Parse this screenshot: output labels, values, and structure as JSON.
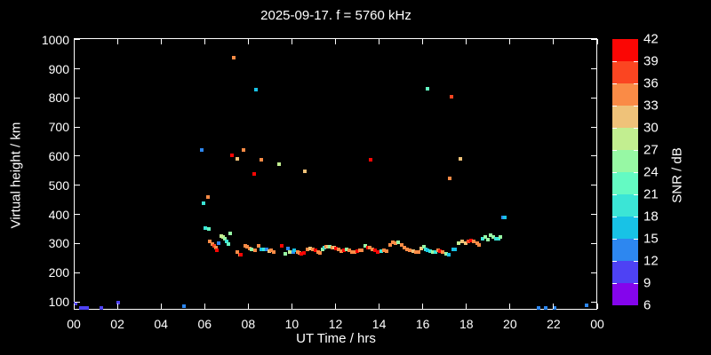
{
  "colors": {
    "background": "#000000",
    "axis": "#ffffff",
    "text": "#ffffff"
  },
  "header": {
    "title": "2025-09-17. f = 5760 kHz"
  },
  "axes": {
    "x_label": "UT Time / hrs",
    "y_label": "Virtual height / km",
    "x_ticks": [
      {
        "label": "00",
        "hour": 0
      },
      {
        "label": "02",
        "hour": 2
      },
      {
        "label": "04",
        "hour": 4
      },
      {
        "label": "06",
        "hour": 6
      },
      {
        "label": "08",
        "hour": 8
      },
      {
        "label": "10",
        "hour": 10
      },
      {
        "label": "12",
        "hour": 12
      },
      {
        "label": "14",
        "hour": 14
      },
      {
        "label": "16",
        "hour": 16
      },
      {
        "label": "18",
        "hour": 18
      },
      {
        "label": "20",
        "hour": 20
      },
      {
        "label": "22",
        "hour": 22
      },
      {
        "label": "00",
        "hour": 24
      }
    ],
    "y_ticks_km": [
      100,
      200,
      300,
      400,
      500,
      600,
      700,
      800,
      900,
      1000
    ]
  },
  "colorbar": {
    "label": "SNR / dB",
    "tick_labels_top_to_bottom": [
      42,
      39,
      36,
      33,
      30,
      27,
      24,
      21,
      18,
      15,
      12,
      9,
      6
    ],
    "bins_top_to_bottom": [
      {
        "min": 39,
        "max": 42,
        "color": "#FB0604"
      },
      {
        "min": 36,
        "max": 39,
        "color": "#FB4521"
      },
      {
        "min": 33,
        "max": 36,
        "color": "#FA8B46"
      },
      {
        "min": 30,
        "max": 33,
        "color": "#EFC279"
      },
      {
        "min": 27,
        "max": 30,
        "color": "#C2EE90"
      },
      {
        "min": 24,
        "max": 27,
        "color": "#97F8A4"
      },
      {
        "min": 21,
        "max": 24,
        "color": "#64FAC3"
      },
      {
        "min": 18,
        "max": 21,
        "color": "#3BE5D6"
      },
      {
        "min": 15,
        "max": 18,
        "color": "#18C2E6"
      },
      {
        "min": 12,
        "max": 15,
        "color": "#2D87F0"
      },
      {
        "min": 9,
        "max": 12,
        "color": "#4E42F4"
      },
      {
        "min": 6,
        "max": 9,
        "color": "#8405EC"
      }
    ]
  },
  "chart_data": {
    "type": "scatter",
    "title": "2025-09-17. f = 5760 kHz",
    "xlabel": "UT Time / hrs",
    "ylabel": "Virtual height / km",
    "color_label": "SNR / dB",
    "xlim_hours": [
      0,
      24
    ],
    "ylim_km": [
      70,
      1000
    ],
    "snr_scale_db": [
      6,
      42
    ],
    "marker": "square-4px",
    "points_time_height_snr": [
      [
        0.07,
        95,
        10
      ],
      [
        0.33,
        79,
        10
      ],
      [
        0.42,
        79,
        10
      ],
      [
        0.52,
        79,
        10
      ],
      [
        0.63,
        79,
        10
      ],
      [
        1.25,
        78,
        10
      ],
      [
        2.02,
        96,
        10
      ],
      [
        5.05,
        85,
        13
      ],
      [
        21.3,
        80,
        13
      ],
      [
        21.65,
        80,
        13
      ],
      [
        22.05,
        80,
        13
      ],
      [
        23.5,
        87,
        13
      ],
      [
        5.85,
        621,
        13
      ],
      [
        5.96,
        437,
        19
      ],
      [
        6.15,
        459,
        34
      ],
      [
        7.24,
        604,
        40
      ],
      [
        7.35,
        937,
        34
      ],
      [
        7.49,
        592,
        31
      ],
      [
        7.78,
        621,
        34
      ],
      [
        8.26,
        539,
        40
      ],
      [
        8.35,
        828,
        16
      ],
      [
        8.59,
        588,
        34
      ],
      [
        9.4,
        572,
        28
      ],
      [
        10.59,
        547,
        31
      ],
      [
        13.62,
        587,
        40
      ],
      [
        16.23,
        832,
        22
      ],
      [
        17.24,
        523,
        34
      ],
      [
        17.31,
        803,
        37
      ],
      [
        17.71,
        590,
        31
      ],
      [
        19.7,
        390,
        13
      ],
      [
        19.78,
        390,
        16
      ],
      [
        6.02,
        352,
        19
      ],
      [
        6.2,
        351,
        22
      ],
      [
        6.25,
        306,
        34
      ],
      [
        6.36,
        298,
        34
      ],
      [
        6.45,
        291,
        37
      ],
      [
        6.52,
        285,
        34
      ],
      [
        6.58,
        278,
        40
      ],
      [
        6.66,
        302,
        13
      ],
      [
        6.75,
        326,
        28
      ],
      [
        6.85,
        321,
        28
      ],
      [
        6.93,
        316,
        25
      ],
      [
        7.0,
        307,
        19
      ],
      [
        7.08,
        298,
        22
      ],
      [
        7.17,
        335,
        25
      ],
      [
        7.5,
        270,
        34
      ],
      [
        7.6,
        263,
        34
      ],
      [
        7.68,
        261,
        40
      ],
      [
        7.85,
        293,
        34
      ],
      [
        7.95,
        289,
        34
      ],
      [
        8.05,
        284,
        34
      ],
      [
        8.13,
        279,
        25
      ],
      [
        8.3,
        277,
        34
      ],
      [
        8.47,
        293,
        34
      ],
      [
        8.6,
        281,
        16
      ],
      [
        8.72,
        280,
        19
      ],
      [
        8.83,
        280,
        13
      ],
      [
        8.95,
        275,
        31
      ],
      [
        9.05,
        278,
        34
      ],
      [
        9.18,
        271,
        34
      ],
      [
        9.53,
        291,
        40
      ],
      [
        9.69,
        266,
        25
      ],
      [
        9.8,
        282,
        13
      ],
      [
        9.92,
        270,
        28
      ],
      [
        10.05,
        272,
        13
      ],
      [
        10.12,
        276,
        16
      ],
      [
        10.25,
        272,
        34
      ],
      [
        10.35,
        268,
        34
      ],
      [
        10.45,
        265,
        40
      ],
      [
        10.55,
        267,
        40
      ],
      [
        10.7,
        281,
        34
      ],
      [
        10.82,
        283,
        31
      ],
      [
        10.95,
        279,
        34
      ],
      [
        11.1,
        277,
        40
      ],
      [
        11.2,
        271,
        34
      ],
      [
        11.3,
        268,
        34
      ],
      [
        11.42,
        281,
        25
      ],
      [
        11.5,
        285,
        19
      ],
      [
        11.58,
        288,
        34
      ],
      [
        11.67,
        290,
        31
      ],
      [
        11.75,
        289,
        25
      ],
      [
        11.85,
        287,
        34
      ],
      [
        11.93,
        285,
        31
      ],
      [
        12.04,
        283,
        40
      ],
      [
        12.15,
        279,
        34
      ],
      [
        12.25,
        275,
        34
      ],
      [
        12.4,
        277,
        40
      ],
      [
        12.5,
        281,
        25
      ],
      [
        12.62,
        277,
        34
      ],
      [
        12.75,
        272,
        34
      ],
      [
        12.87,
        270,
        34
      ],
      [
        13.0,
        275,
        40
      ],
      [
        13.12,
        277,
        34
      ],
      [
        13.22,
        277,
        34
      ],
      [
        13.37,
        293,
        25
      ],
      [
        13.47,
        287,
        40
      ],
      [
        13.57,
        285,
        34
      ],
      [
        13.68,
        281,
        34
      ],
      [
        13.82,
        277,
        40
      ],
      [
        13.95,
        272,
        40
      ],
      [
        14.11,
        275,
        19
      ],
      [
        14.22,
        278,
        34
      ],
      [
        14.33,
        275,
        34
      ],
      [
        14.5,
        296,
        34
      ],
      [
        14.62,
        304,
        34
      ],
      [
        14.75,
        301,
        34
      ],
      [
        14.88,
        303,
        25
      ],
      [
        15.02,
        295,
        34
      ],
      [
        15.15,
        287,
        34
      ],
      [
        15.27,
        280,
        34
      ],
      [
        15.42,
        276,
        34
      ],
      [
        15.55,
        273,
        31
      ],
      [
        15.7,
        271,
        34
      ],
      [
        15.83,
        272,
        34
      ],
      [
        15.95,
        283,
        31
      ],
      [
        16.04,
        289,
        25
      ],
      [
        16.12,
        281,
        19
      ],
      [
        16.22,
        277,
        16
      ],
      [
        16.34,
        274,
        19
      ],
      [
        16.46,
        272,
        25
      ],
      [
        16.58,
        270,
        19
      ],
      [
        16.7,
        276,
        34
      ],
      [
        16.8,
        273,
        40
      ],
      [
        16.92,
        272,
        34
      ],
      [
        17.08,
        266,
        25
      ],
      [
        17.2,
        262,
        16
      ],
      [
        17.38,
        281,
        16
      ],
      [
        17.5,
        279,
        16
      ],
      [
        17.65,
        301,
        28
      ],
      [
        17.82,
        306,
        31
      ],
      [
        17.95,
        301,
        31
      ],
      [
        18.1,
        308,
        37
      ],
      [
        18.22,
        310,
        40
      ],
      [
        18.35,
        307,
        34
      ],
      [
        18.48,
        302,
        34
      ],
      [
        18.6,
        296,
        34
      ],
      [
        18.73,
        315,
        19
      ],
      [
        18.86,
        321,
        25
      ],
      [
        18.98,
        313,
        25
      ],
      [
        19.12,
        329,
        25
      ],
      [
        19.24,
        322,
        25
      ],
      [
        19.36,
        317,
        19
      ],
      [
        19.47,
        315,
        19
      ],
      [
        19.57,
        323,
        25
      ]
    ]
  }
}
